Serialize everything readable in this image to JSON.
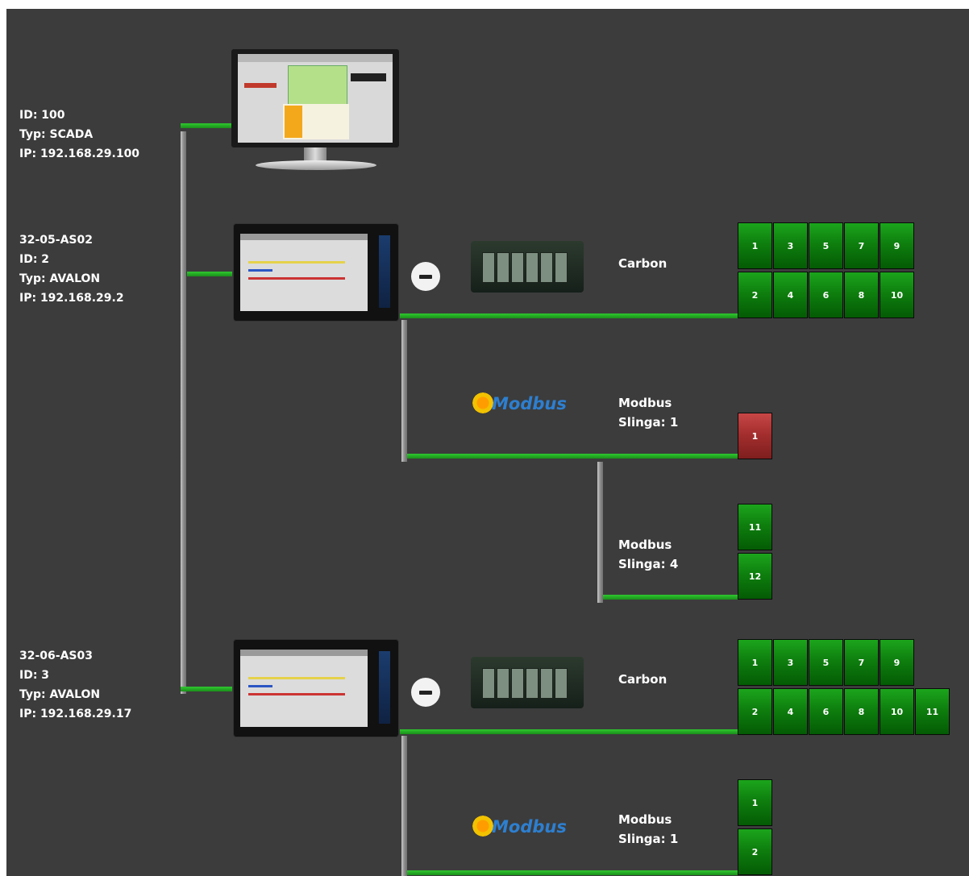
{
  "devices": {
    "scada": {
      "line1": "ID: 100",
      "line2": "Typ: SCADA",
      "line3": "IP: 192.168.29.100"
    },
    "as02": {
      "line1": "32-05-AS02",
      "line2": "ID: 2",
      "line3": "Typ: AVALON",
      "line4": "IP: 192.168.29.2"
    },
    "as03": {
      "line1": "32-06-AS03",
      "line2": "ID: 3",
      "line3": "Typ: AVALON",
      "line4": "IP: 192.168.29.17"
    }
  },
  "buses": {
    "carbon1": {
      "title": "Carbon"
    },
    "modbus1a": {
      "title": "Modbus",
      "loop": "Slinga: 1"
    },
    "modbus1b": {
      "title": "Modbus",
      "loop": "Slinga: 4"
    },
    "carbon2": {
      "title": "Carbon"
    },
    "modbus2a": {
      "title": "Modbus",
      "loop": "Slinga: 1"
    }
  },
  "modules": {
    "carbon1_top": [
      "1",
      "3",
      "5",
      "7",
      "9"
    ],
    "carbon1_bottom": [
      "2",
      "4",
      "6",
      "8",
      "10"
    ],
    "modbus1a": [
      {
        "label": "1",
        "status": "error"
      }
    ],
    "modbus1b": [
      "11",
      "12"
    ],
    "carbon2_top": [
      "1",
      "3",
      "5",
      "7",
      "9"
    ],
    "carbon2_bottom": [
      "2",
      "4",
      "6",
      "8",
      "10",
      "11"
    ],
    "modbus2a": [
      "1",
      "2"
    ]
  },
  "logo_text": "Modbus",
  "colors": {
    "background": "#3c3c3c",
    "ok": "#0e7f0e",
    "error": "#a52e2e",
    "link": "#2fc82f",
    "trunk": "#8e8e8e"
  }
}
